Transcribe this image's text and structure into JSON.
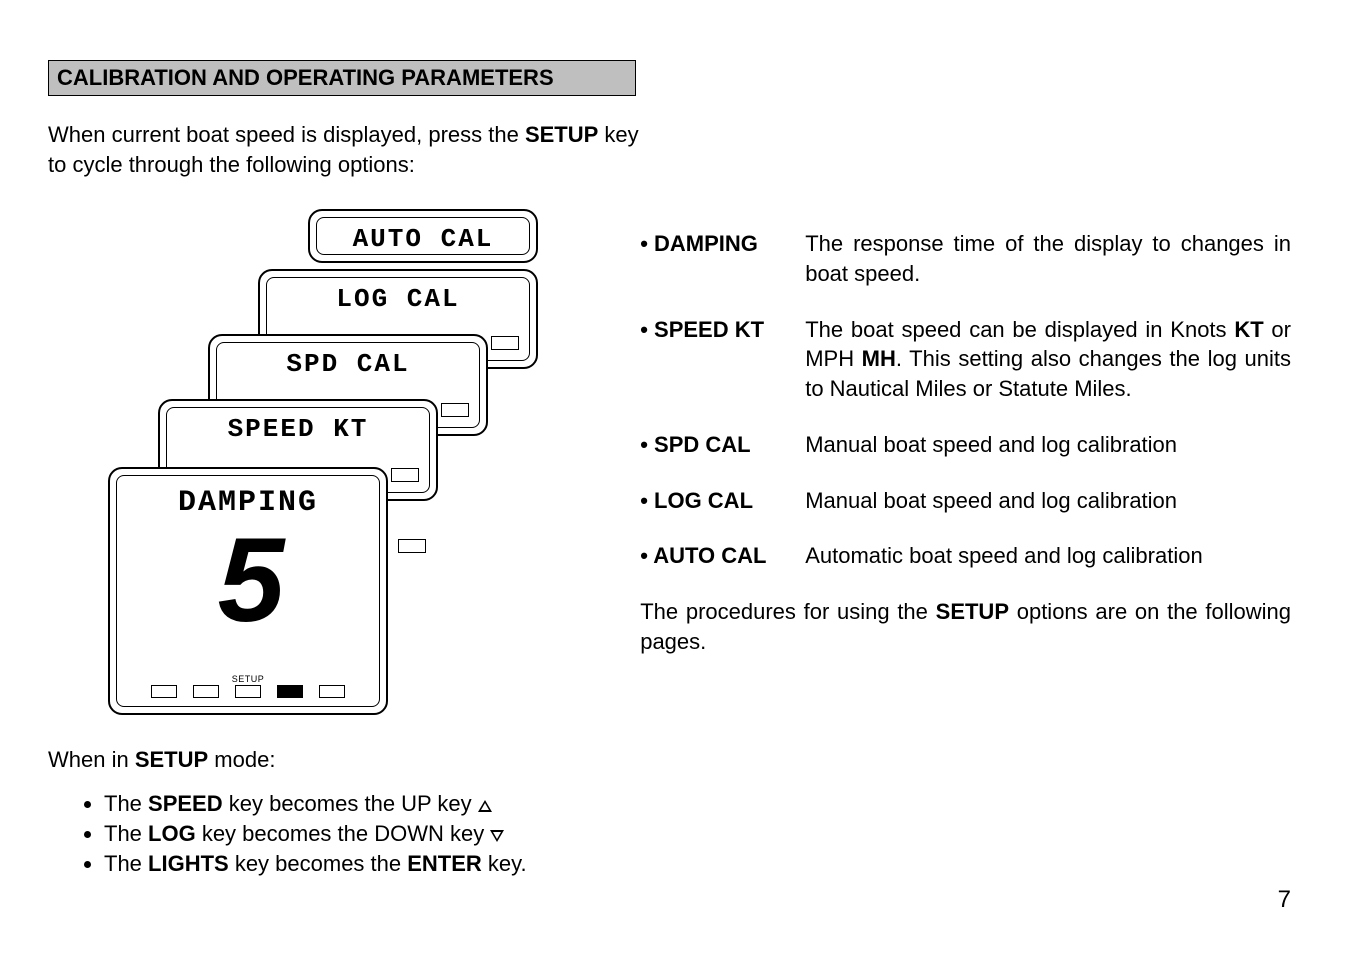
{
  "header": "CALIBRATION AND OPERATING PARAMETERS",
  "intro": "When current boat speed is displayed, press the SETUP key to cycle through the following options:",
  "intro_parts": {
    "before": "When current boat speed is displayed, press the ",
    "key": "SETUP",
    "after": " key to cycle through the following options:"
  },
  "lcd_labels": {
    "auto_cal": "AUTO CAL",
    "log_cal": "LOG  CAL",
    "spd_cal": "SPD  CAL",
    "speed_kt": "SPEED KT",
    "damping": "DAMPING",
    "digit": "5",
    "setup": "SETUP"
  },
  "setup_mode": {
    "before": "When in ",
    "key": "SETUP",
    "after": " mode:"
  },
  "bullets": [
    {
      "pre": "The ",
      "b1": "SPEED",
      "mid": " key becomes the UP key ",
      "icon": "up"
    },
    {
      "pre": "The ",
      "b1": "LOG",
      "mid": " key becomes the DOWN key ",
      "icon": "down"
    },
    {
      "pre": "The ",
      "b1": "LIGHTS",
      "mid": " key becomes the ",
      "b2": "ENTER",
      "end": " key."
    }
  ],
  "defs": [
    {
      "term": "• DAMPING",
      "desc_parts": [
        {
          "t": "The response time of the display to changes in boat speed."
        }
      ]
    },
    {
      "term": "• SPEED KT",
      "desc_parts": [
        {
          "t": "The boat speed can be displayed in Knots "
        },
        {
          "b": "KT"
        },
        {
          "t": " or MPH "
        },
        {
          "b": "MH"
        },
        {
          "t": ". This setting also changes the log units to Nautical Miles or Statute Miles."
        }
      ]
    },
    {
      "term": "• SPD CAL",
      "desc_parts": [
        {
          "t": "Manual boat speed and log calibration"
        }
      ]
    },
    {
      "term": "• LOG CAL",
      "desc_parts": [
        {
          "t": "Manual boat speed and log calibration"
        }
      ]
    },
    {
      "term": "• AUTO CAL",
      "desc_parts": [
        {
          "t": "Automatic boat speed and log calibration"
        }
      ]
    }
  ],
  "follow": {
    "before": "The procedures for using the ",
    "key": "SETUP",
    "after": " options are on the following pages."
  },
  "page_number": "7"
}
